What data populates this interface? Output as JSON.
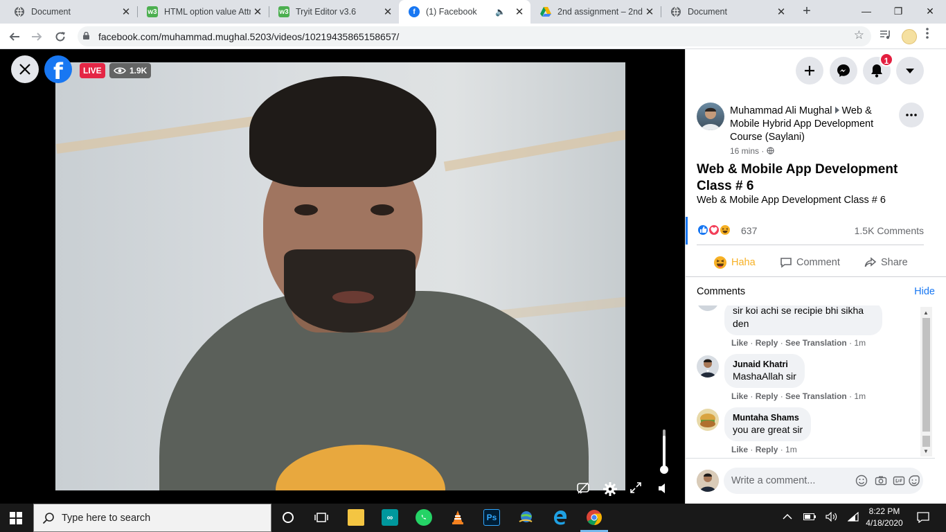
{
  "browser": {
    "tabs": [
      {
        "title": "Document",
        "icon": "globe-icon",
        "color": "#5f6368",
        "active": false
      },
      {
        "title": "HTML option value Attr",
        "icon": "w3schools-icon",
        "color": "#4caf50",
        "active": false
      },
      {
        "title": "Tryit Editor v3.6",
        "icon": "w3schools-icon",
        "color": "#4caf50",
        "active": false
      },
      {
        "title": "(1) Facebook",
        "icon": "facebook-icon",
        "color": "#1877f2",
        "active": true
      },
      {
        "title": "2nd assignment – 2nd a",
        "icon": "google-drive-icon",
        "color": "#f4b400",
        "active": false
      },
      {
        "title": "Document",
        "icon": "globe-icon",
        "color": "#5f6368",
        "active": false
      }
    ],
    "url": "facebook.com/muhammad.mughal.5203/videos/10219435865158657/"
  },
  "video": {
    "live_label": "LIVE",
    "viewer_count": "1.9K",
    "volume_level": 0.85
  },
  "header": {
    "notification_count": "1"
  },
  "post": {
    "author": "Muhammad Ali Mughal",
    "group": "Web & Mobile Hybrid App Development Course (Saylani)",
    "time": "16 mins ·",
    "title": "Web & Mobile App Development Class # 6",
    "description": "Web & Mobile App Development Class # 6",
    "reaction_count": "637",
    "comments_count": "1.5K Comments",
    "actions": {
      "haha": "Haha",
      "comment": "Comment",
      "share": "Share"
    }
  },
  "comments": {
    "header": "Comments",
    "hide": "Hide",
    "items": [
      {
        "name": "",
        "text_line1": "sir koi achi se recipie bhi sikha",
        "text_line2": "den",
        "like": "Like",
        "reply": "Reply",
        "translate": "See Translation",
        "time": "1m"
      },
      {
        "name": "Junaid Khatri",
        "text": "MashaAllah sir",
        "like": "Like",
        "reply": "Reply",
        "translate": "See Translation",
        "time": "1m"
      },
      {
        "name": "Muntaha Shams",
        "text": "you are great sir",
        "like": "Like",
        "reply": "Reply",
        "time": "1m"
      }
    ],
    "write_placeholder": "Write a comment..."
  },
  "taskbar": {
    "search_placeholder": "Type here to search",
    "time": "8:22 PM",
    "date": "4/18/2020"
  }
}
